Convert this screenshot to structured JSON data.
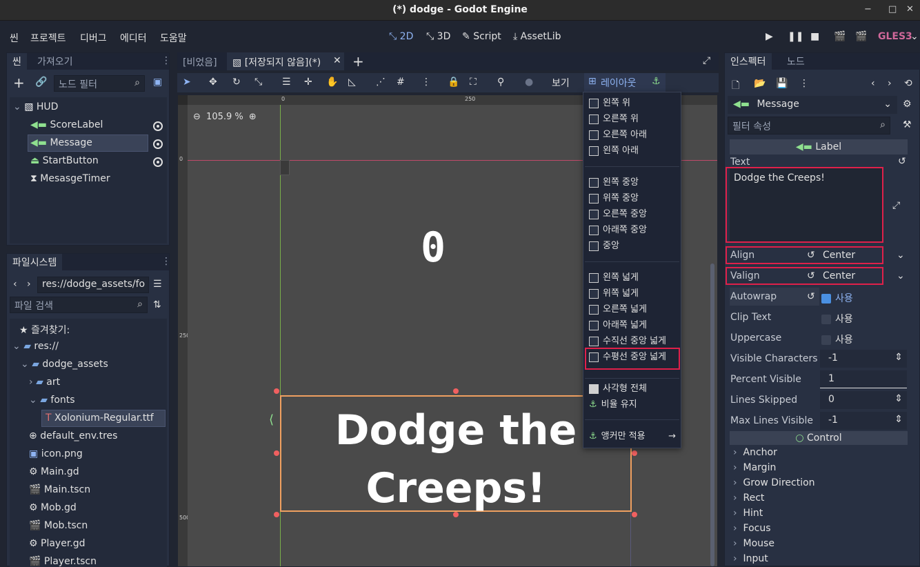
{
  "window": {
    "title": "(*) dodge - Godot Engine",
    "controls": [
      "−",
      "□",
      "✕"
    ]
  },
  "menubar": {
    "items": [
      "씬",
      "프로젝트",
      "디버그",
      "에디터",
      "도움말"
    ],
    "modes": [
      "2D",
      "3D",
      "Script",
      "AssetLib"
    ],
    "renderer": "GLES3"
  },
  "scene_dock": {
    "tabs": [
      "씬",
      "가져오기"
    ],
    "filter_placeholder": "노드 필터",
    "tree": [
      {
        "label": "HUD",
        "selected": false
      },
      {
        "label": "ScoreLabel",
        "selected": false
      },
      {
        "label": "Message",
        "selected": true
      },
      {
        "label": "StartButton",
        "selected": false
      },
      {
        "label": "MesasgeTimer",
        "selected": false
      }
    ]
  },
  "filesystem_dock": {
    "tab": "파일시스템",
    "path": "res://dodge_assets/fo",
    "search_placeholder": "파일 검색",
    "items": [
      "즐겨찾기:",
      "res://",
      "dodge_assets",
      "art",
      "fonts",
      "Xolonium-Regular.ttf",
      "default_env.tres",
      "icon.png",
      "Main.gd",
      "Main.tscn",
      "Mob.gd",
      "Mob.tscn",
      "Player.gd",
      "Player.tscn"
    ]
  },
  "editor_tabs": {
    "tabs": [
      "[비었음]",
      "[저장되지 않음](*)"
    ]
  },
  "toolbar": {
    "view_label": "보기",
    "layout_label": "레이아웃"
  },
  "viewport": {
    "zoom": "105.9 %",
    "score": "0",
    "message_line1": "Dodge the",
    "message_line2": "Creeps!",
    "ruler_h": [
      "0",
      "250"
    ],
    "ruler_v": [
      "0",
      "250",
      "500"
    ]
  },
  "layout_menu": {
    "group1": [
      "왼쪽 위",
      "오른쪽 위",
      "오른쪽 아래",
      "왼쪽 아래"
    ],
    "group2": [
      "왼쪽 중앙",
      "위쪽 중앙",
      "오른쪽 중앙",
      "아래쪽 중앙",
      "중앙"
    ],
    "group3": [
      "왼쪽 넓게",
      "위쪽 넓게",
      "오른쪽 넓게",
      "아래쪽 넓게",
      "수직선 중앙 넓게",
      "수평선 중앙 넓게"
    ],
    "group4": [
      "사각형 전체",
      "비율 유지"
    ],
    "anchors_only": "앵커만 적용",
    "highlighted": "수평선 중앙 넓게"
  },
  "inspector": {
    "tabs": [
      "인스펙터",
      "노드"
    ],
    "node_name": "Message",
    "filter_placeholder": "필터 속성",
    "class_header": "Label",
    "text_label": "Text",
    "text_value": "Dodge the Creeps!",
    "props": [
      {
        "name": "Align",
        "value": "Center"
      },
      {
        "name": "Valign",
        "value": "Center"
      },
      {
        "name": "Autowrap",
        "value": "사용",
        "checked": true
      },
      {
        "name": "Clip Text",
        "value": "사용",
        "checked": false
      },
      {
        "name": "Uppercase",
        "value": "사용",
        "checked": false
      },
      {
        "name": "Visible Characters",
        "value": "-1"
      },
      {
        "name": "Percent Visible",
        "value": "1"
      },
      {
        "name": "Lines Skipped",
        "value": "0"
      },
      {
        "name": "Max Lines Visible",
        "value": "-1"
      }
    ],
    "control_header": "Control",
    "sections": [
      "Anchor",
      "Margin",
      "Grow Direction",
      "Rect",
      "Hint",
      "Focus",
      "Mouse",
      "Input"
    ]
  },
  "colors": {
    "accent": "#8eb3f2",
    "highlight": "#e0204a",
    "selection": "#f0a060"
  }
}
